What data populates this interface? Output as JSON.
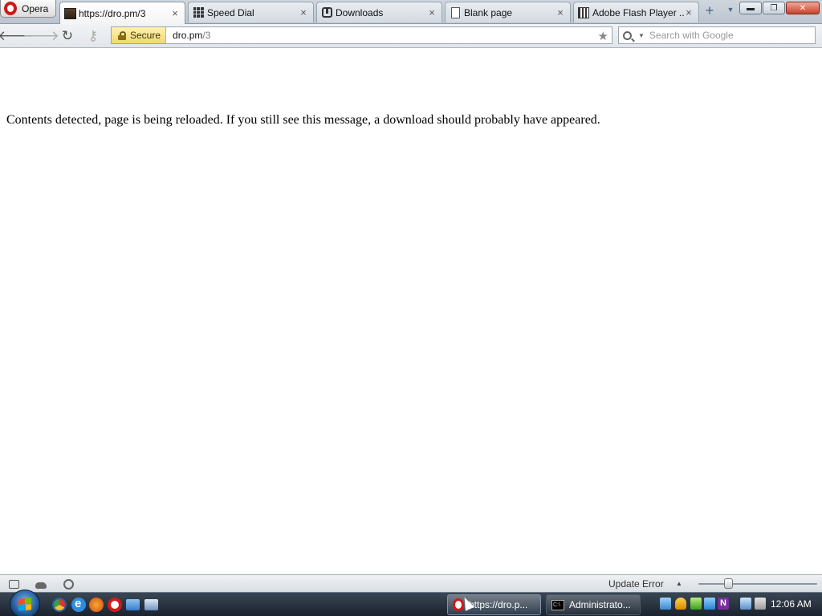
{
  "browser": {
    "menu_label": "Opera",
    "tabs": [
      {
        "title": "https://dro.pm/3",
        "favicon": "dark-image-icon",
        "active": true
      },
      {
        "title": "Speed Dial",
        "favicon": "speed-dial-grid-icon",
        "active": false
      },
      {
        "title": "Downloads",
        "favicon": "downloads-icon",
        "active": false
      },
      {
        "title": "Blank page",
        "favicon": "blank-page-icon",
        "active": false
      },
      {
        "title": "Adobe Flash Player ...",
        "favicon": "flash-player-icon",
        "active": false
      }
    ],
    "tab_close_glyph": "×",
    "new_tab_glyph": "+",
    "tab_menu_glyph": "▼",
    "window_controls": {
      "minimize": "▬",
      "restore": "❐",
      "close": "✕"
    }
  },
  "toolbar": {
    "back_glyph": "🡐",
    "forward_glyph": "🡒",
    "reload_glyph": "↻",
    "key_glyph": "⚷",
    "security_label": "Secure",
    "url_host": "dro.pm",
    "url_path": "/3",
    "bookmark_glyph": "★",
    "search_placeholder": "Search with Google",
    "search_dropdown_glyph": "▼"
  },
  "page": {
    "message": "Contents detected, page is being reloaded. If you still see this message, a download should probably have appeared."
  },
  "statusbar": {
    "update_text": "Update Error",
    "update_arrow": "▲",
    "zoom_level": 0.25
  },
  "taskbar": {
    "items": [
      {
        "title": "https://dro.p...",
        "icon": "opera-icon",
        "active": true
      },
      {
        "title": "Administrato...",
        "icon": "cmd-icon",
        "active": false
      }
    ],
    "clock": "12:06 AM",
    "colors": {
      "start_orb": "#1c4f8a",
      "opera_red": "#d11a1a",
      "secure_yellow": "#f1d770"
    }
  }
}
